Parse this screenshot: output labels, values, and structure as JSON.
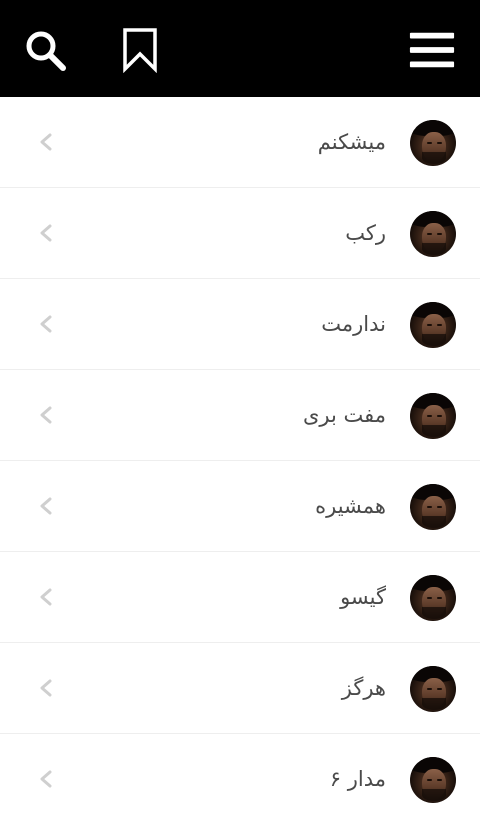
{
  "header": {
    "search_icon": "search-icon",
    "bookmark_icon": "bookmark-icon",
    "menu_icon": "hamburger-menu-icon",
    "background": "#000000",
    "icon_color": "#ffffff"
  },
  "songs": [
    {
      "title": "میشکنم"
    },
    {
      "title": "رکب"
    },
    {
      "title": "ندارمت"
    },
    {
      "title": "مفت بری"
    },
    {
      "title": "همشیره"
    },
    {
      "title": "گیسو"
    },
    {
      "title": "هرگز"
    },
    {
      "title": "مدار ۶"
    }
  ],
  "row_chevron_icon": "chevron-left-icon",
  "colors": {
    "text": "#4a4a4a",
    "chevron": "#cfcfcf",
    "divider": "#eeeeee"
  }
}
